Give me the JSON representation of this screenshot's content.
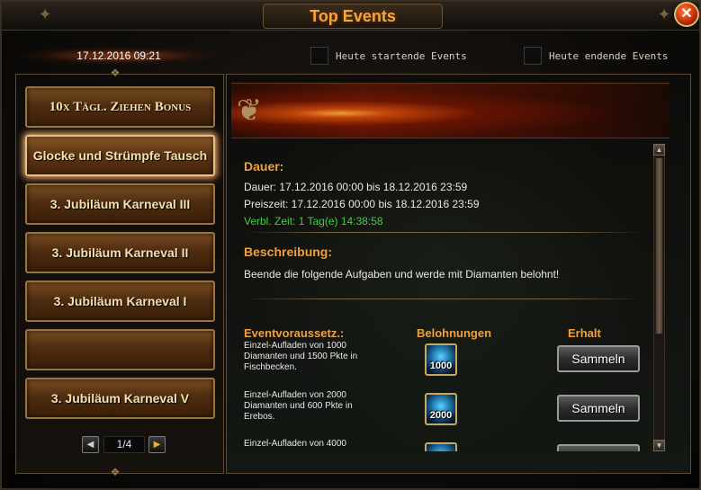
{
  "window": {
    "title": "Top Events",
    "close_label": "✕"
  },
  "top": {
    "datetime": "17.12.2016 09:21",
    "filter_starting_label": "Heute startende Events",
    "filter_ending_label": "Heute endende Events"
  },
  "sidebar": {
    "items": [
      {
        "label": "10x Tägl. Ziehen Bonus"
      },
      {
        "label": "Glocke und Strümpfe Tausch"
      },
      {
        "label": "3. Jubiläum Karneval III"
      },
      {
        "label": "3. Jubiläum Karneval II"
      },
      {
        "label": "3. Jubiläum Karneval I"
      },
      {
        "label": ""
      },
      {
        "label": "3. Jubiläum Karneval V"
      }
    ],
    "selected_index": 1,
    "pager": {
      "label": "1/4",
      "prev_icon": "arrow-left-icon",
      "next_icon": "arrow-right-icon"
    }
  },
  "detail": {
    "duration_title": "Dauer:",
    "duration_text": "Dauer: 17.12.2016 00:00 bis 18.12.2016 23:59",
    "prize_text": "Preiszeit: 17.12.2016 00:00 bis 18.12.2016 23:59",
    "remaining_text": "Verbl. Zeit: 1 Tag(e)  14:38:58",
    "description_title": "Beschreibung:",
    "description_text": "Beende die folgende Aufgaben und werde mit Diamanten belohnt!",
    "columns": {
      "requirement": "Eventvoraussetz.:",
      "rewards": "Belohnungen",
      "received": "Erhalt"
    },
    "tasks": [
      {
        "line1": "Einzel-Aufladen von 1000",
        "line2": "Diamanten und 1500 Pkte in",
        "line3": "Fischbecken.",
        "reward": "1000",
        "button": "Sammeln"
      },
      {
        "line1": "Einzel-Aufladen von 2000",
        "line2": "Diamanten und 600 Pkte in",
        "line3": "Erebos.",
        "reward": "2000",
        "button": "Sammeln"
      },
      {
        "line1": "Einzel-Aufladen von 4000",
        "line2": "",
        "line3": "",
        "reward": "",
        "button": ""
      }
    ]
  },
  "colors": {
    "accent_orange": "#f0a040",
    "remaining_green": "#40d040",
    "title_orange": "#f2a640"
  }
}
